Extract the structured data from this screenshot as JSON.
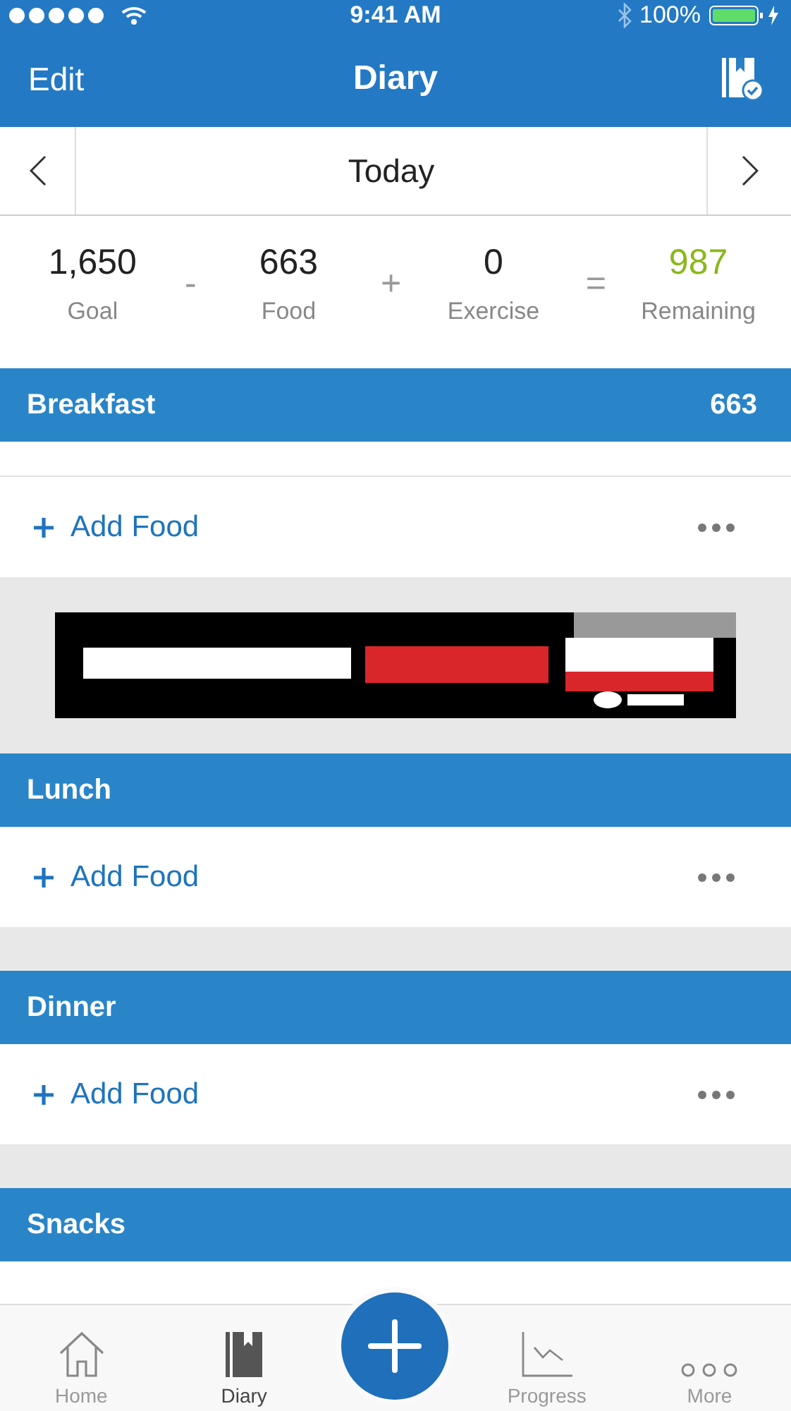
{
  "status_bar": {
    "time": "9:41 AM",
    "battery": "100%"
  },
  "nav": {
    "left": "Edit",
    "title": "Diary"
  },
  "date": {
    "label": "Today"
  },
  "summary": [
    {
      "value": "1,650",
      "label": "Goal",
      "kind": "term"
    },
    {
      "op": "-"
    },
    {
      "value": "663",
      "label": "Food",
      "kind": "term"
    },
    {
      "op": "+"
    },
    {
      "value": "0",
      "label": "Exercise",
      "kind": "term"
    },
    {
      "op": "="
    },
    {
      "value": "987",
      "label": "Remaining",
      "kind": "result"
    }
  ],
  "sections": [
    {
      "kind": "meal",
      "name": "Breakfast",
      "calories": "663",
      "add_label": "Add Food"
    },
    {
      "kind": "ad"
    },
    {
      "kind": "meal",
      "name": "Lunch",
      "add_label": "Add Food"
    },
    {
      "kind": "meal",
      "name": "Dinner",
      "add_label": "Add Food"
    },
    {
      "kind": "meal",
      "name": "Snacks"
    }
  ],
  "tabs": [
    {
      "kind": "tab",
      "label": "Home",
      "selected": false
    },
    {
      "kind": "tab",
      "label": "Diary",
      "selected": true
    },
    {
      "kind": "add"
    },
    {
      "kind": "tab",
      "label": "Progress",
      "selected": false
    },
    {
      "kind": "tab",
      "label": "More",
      "selected": false
    }
  ]
}
